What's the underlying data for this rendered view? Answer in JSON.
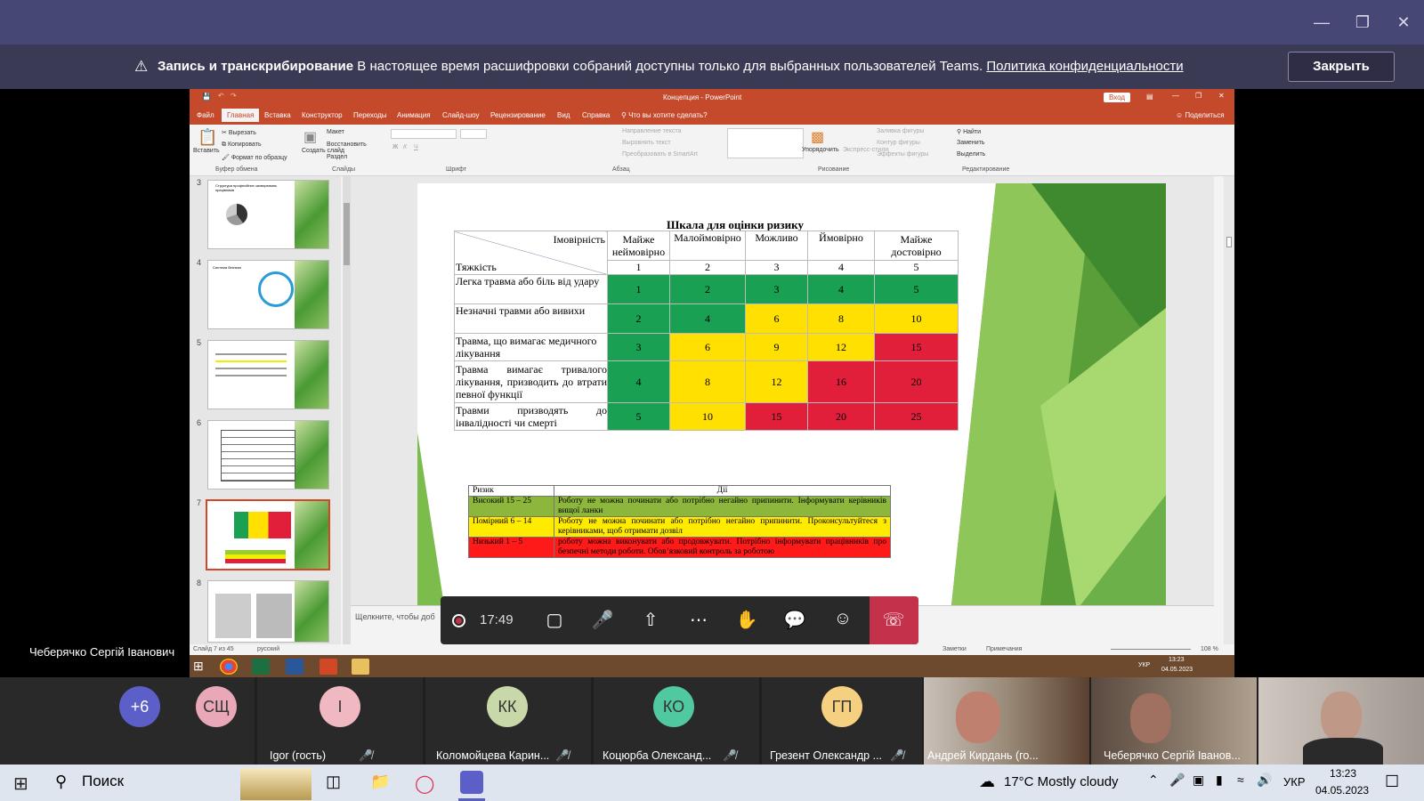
{
  "banner": {
    "title": "Запись и транскрибирование",
    "text": "В настоящее время расшифровки собраний доступны только для выбранных пользователей Teams.",
    "link": "Политика конфиденциальности",
    "close": "Закрыть"
  },
  "ppt": {
    "window_title": "Концепция - PowerPoint",
    "signin": "Вход",
    "share": "Поделиться",
    "tabs": [
      "Файл",
      "Главная",
      "Вставка",
      "Конструктор",
      "Переходы",
      "Анимация",
      "Слайд-шоу",
      "Рецензирование",
      "Вид",
      "Справка",
      "Что вы хотите сделать?"
    ],
    "ribbon": {
      "paste": "Вставить",
      "cut": "Вырезать",
      "copy": "Копировать",
      "format": "Формат по образцу",
      "clipboard": "Буфер обмена",
      "new_slide": "Создать слайд",
      "layout": "Макет",
      "reset": "Восстановить",
      "section": "Раздел",
      "slides": "Слайды",
      "font": "Шрифт",
      "paragraph": "Абзац",
      "text_dir": "Направление текста",
      "align_text": "Выровнять текст",
      "smartart": "Преобразовать в SmartArt",
      "arrange": "Упорядочить",
      "quick_styles": "Экспресс-стили",
      "fill": "Заливка фигуры",
      "outline": "Контур фигуры",
      "effects": "Эффекты фигуры",
      "drawing": "Рисование",
      "find": "Найти",
      "replace": "Заменить",
      "select": "Выделить",
      "editing": "Редактирование"
    },
    "thumb_numbers": [
      "3",
      "4",
      "5",
      "6",
      "7",
      "8"
    ],
    "thumb3_title": "Структура професійних захворювань працівників",
    "thumb4_title": "Система безпеки",
    "notes_placeholder": "Щелкните, чтобы доб",
    "status_slide": "Слайд 7 из 45",
    "status_lang": "русский",
    "status_notes": "Заметки",
    "status_comments": "Примечания",
    "zoom": "108 %",
    "task_lang": "УКР",
    "task_time": "13:23",
    "task_date": "04.05.2023"
  },
  "slide": {
    "title": "Шкала для оцінки ризику",
    "prob_label": "Імовірність",
    "sev_label": "Тяжкість",
    "columns": [
      "Майже неймовірно",
      "Малоймовірно",
      "Можливо",
      "Ймовірно",
      "Майже достовірно"
    ],
    "col_nums": [
      "1",
      "2",
      "3",
      "4",
      "5"
    ],
    "rows": [
      {
        "label": "Легка травма або біль від удару",
        "cells": [
          "1",
          "2",
          "3",
          "4",
          "5"
        ]
      },
      {
        "label": "Незначні травми або вивихи",
        "cells": [
          "2",
          "4",
          "6",
          "8",
          "10"
        ]
      },
      {
        "label": "Травма, що вимагає медичного лікування",
        "cells": [
          "3",
          "6",
          "9",
          "12",
          "15"
        ]
      },
      {
        "label": "Травма вимагає тривалого лікування, призводить до втрати певної функції",
        "cells": [
          "4",
          "8",
          "12",
          "16",
          "20"
        ]
      },
      {
        "label": "Травми призводять до інвалідності чи смерті",
        "cells": [
          "5",
          "10",
          "15",
          "20",
          "25"
        ]
      }
    ],
    "action_headers": [
      "Ризик",
      "Дії"
    ],
    "actions": [
      {
        "risk": "Високий 15 – 25",
        "text": "Роботу не можна починати або потрібно негайно припинити. Інформувати керівників вищої ланки"
      },
      {
        "risk": "Помірний 6 – 14",
        "text": "Роботу не можна починати або потрібно негайно припинити. Проконсультуйтеся з керівниками, щоб отримати дозвіл"
      },
      {
        "risk": "Низький 1 – 5",
        "text": "роботу можна виконувати або продовжувати. Потрібно інформувати працівників про безпечні методи роботи. Обов’язковий контроль за роботою"
      }
    ],
    "colors": {
      "green": "#1aa053",
      "yellow": "#ffe000",
      "red": "#e21f3a"
    }
  },
  "call": {
    "timer": "17:49",
    "presenter": "Чеберячко Сергій Іванович"
  },
  "participants": [
    {
      "initials": "+6",
      "name": ""
    },
    {
      "initials": "СЩ",
      "name": ""
    },
    {
      "initials": "I",
      "name": "Igor (гость)"
    },
    {
      "initials": "КК",
      "name": "Коломойцева Карин..."
    },
    {
      "initials": "КО",
      "name": "Коцюрба Олександ..."
    },
    {
      "initials": "ГП",
      "name": "Грезент Олександр ..."
    },
    {
      "initials": "",
      "name": "Андрей Кирдань (го..."
    },
    {
      "initials": "",
      "name": "Чеберячко Сергій Іванов..."
    }
  ],
  "taskbar": {
    "search": "Поиск",
    "weather": "17°C  Mostly cloudy",
    "lang": "УКР",
    "time": "13:23",
    "date": "04.05.2023"
  }
}
